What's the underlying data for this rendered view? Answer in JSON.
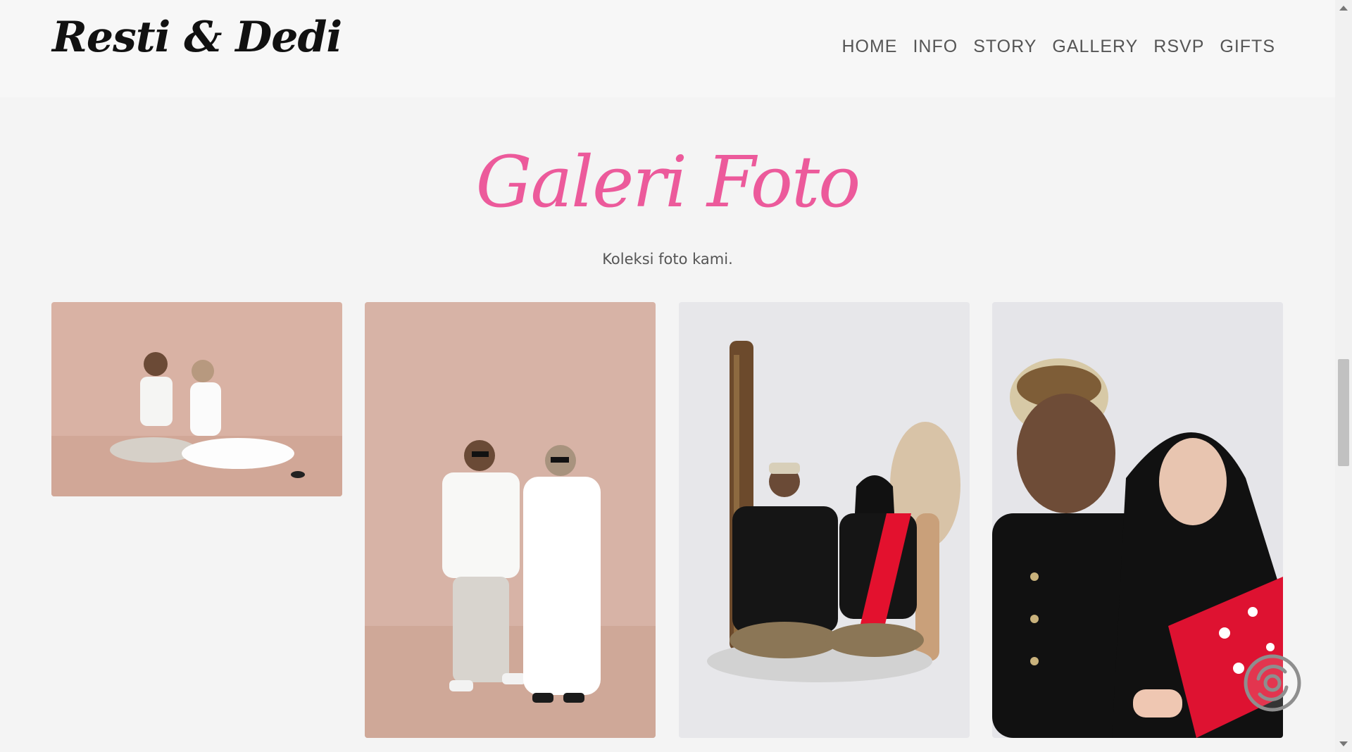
{
  "header": {
    "logo": "Resti & Dedi",
    "nav": [
      "HOME",
      "INFO",
      "STORY",
      "GALLERY",
      "RSVP",
      "GIFTS"
    ]
  },
  "gallery": {
    "title": "Galeri Foto",
    "subtitle": "Koleksi foto kami.",
    "photos": [
      {
        "name": "couple-sitting-floor-white-outfits"
      },
      {
        "name": "couple-sitting-chairs-sunglasses"
      },
      {
        "name": "couple-traditional-javanese-sitting"
      },
      {
        "name": "couple-traditional-closeup"
      }
    ]
  },
  "colors": {
    "accent": "#ec5a9b",
    "background": "#f4f4f4",
    "header_bg": "#f7f7f7",
    "nav_text": "#555555"
  },
  "icons": {
    "music": "music-disc-icon"
  }
}
